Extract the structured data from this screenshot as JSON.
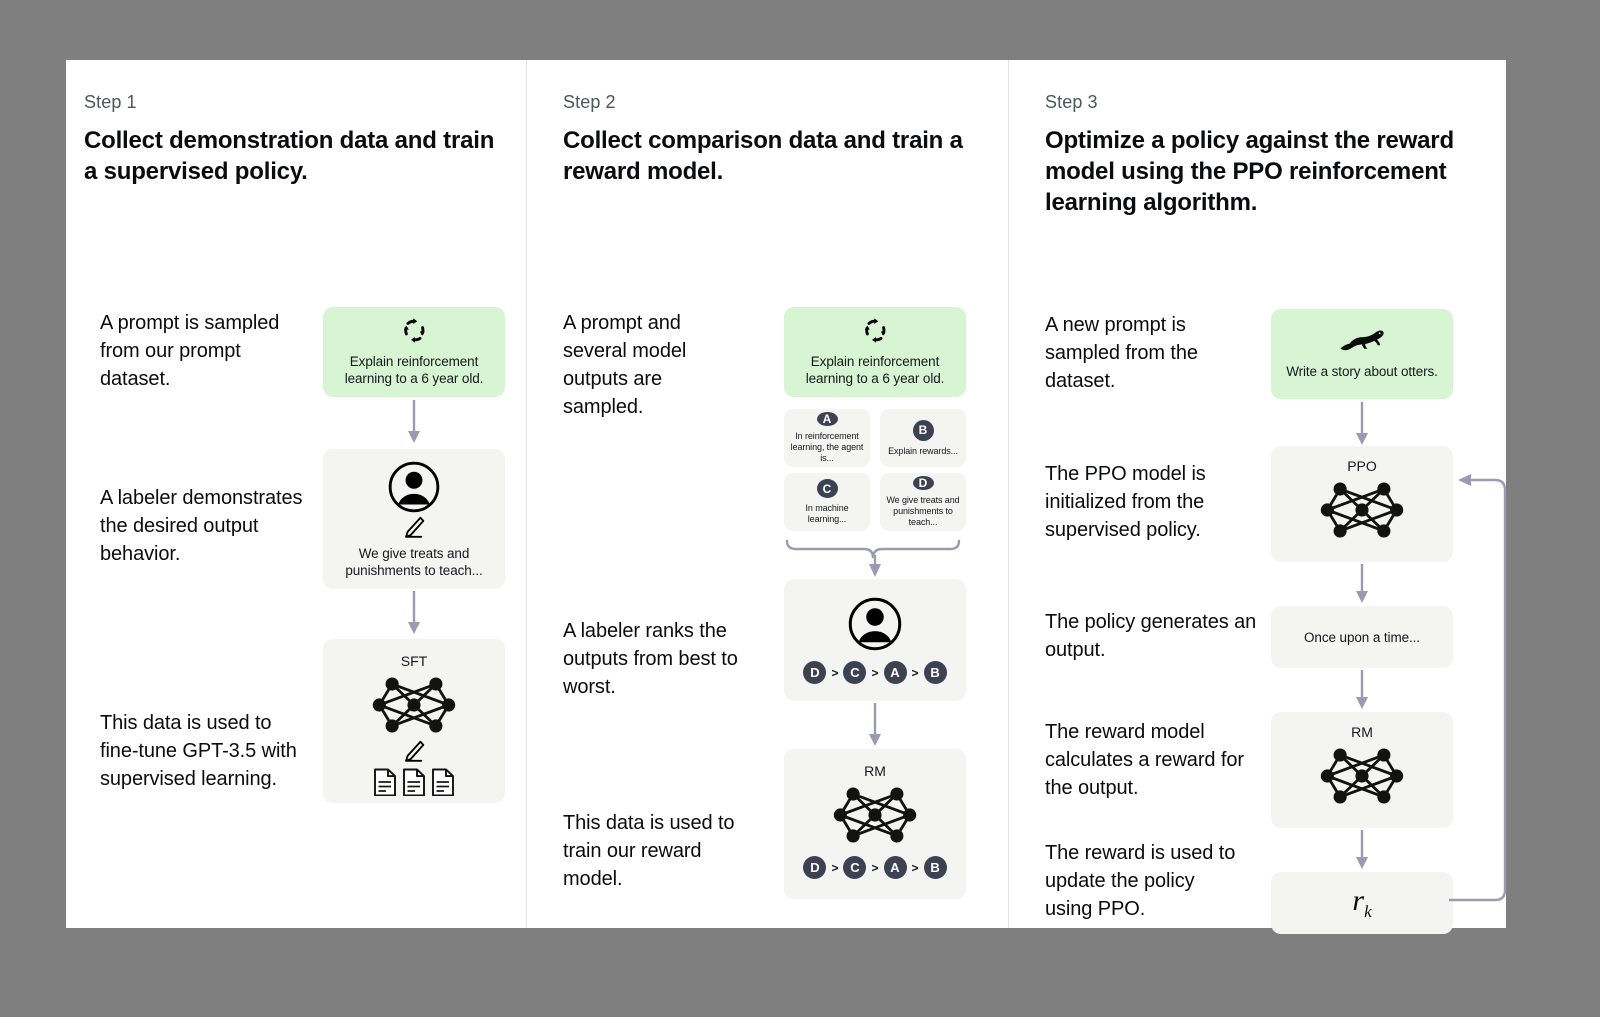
{
  "theme": {
    "background": "#7f7f7f",
    "card_background": "#ffffff",
    "green_box": "#d8f5d3",
    "gray_box": "#f4f4f2",
    "badge": "#3c4252",
    "arrow": "#9a9ab0",
    "text": "#0b0c0e",
    "step_label": "#50545c"
  },
  "columns": [
    {
      "step_label": "Step 1",
      "title": "Collect demonstration data and train a supervised policy.",
      "descriptions": [
        "A prompt is sampled from our prompt dataset.",
        "A labeler demonstrates the desired output behavior.",
        "This data is used to fine-tune GPT-3.5 with supervised learning."
      ],
      "prompt_box": {
        "icon": "cycle-icon",
        "text": "Explain reinforcement learning to a 6 year old."
      },
      "labeler_box": {
        "icon": "person-circle-icon",
        "pencil": "pencil-icon",
        "text": "We give treats and punishments to teach..."
      },
      "model_box": {
        "caption": "SFT",
        "icon": "neural-network-icon",
        "pencil": "pencil-icon",
        "documents": [
          "document-icon",
          "document-icon",
          "document-icon"
        ]
      }
    },
    {
      "step_label": "Step 2",
      "title": "Collect comparison data and train a reward model.",
      "descriptions": [
        "A prompt and several model outputs are sampled.",
        "A labeler ranks the outputs from best to worst.",
        "This data is used to train our reward model."
      ],
      "prompt_box": {
        "icon": "cycle-icon",
        "text": "Explain reinforcement learning to a 6 year old."
      },
      "outputs": [
        {
          "label": "A",
          "text": "In reinforcement learning, the agent is..."
        },
        {
          "label": "B",
          "text": "Explain rewards..."
        },
        {
          "label": "C",
          "text": "In machine learning..."
        },
        {
          "label": "D",
          "text": "We give treats and punishments to teach..."
        }
      ],
      "ranking_box": {
        "icon": "person-circle-icon",
        "ranking": [
          "D",
          "C",
          "A",
          "B"
        ],
        "separator": ">"
      },
      "reward_model_box": {
        "caption": "RM",
        "icon": "neural-network-icon",
        "ranking": [
          "D",
          "C",
          "A",
          "B"
        ],
        "separator": ">"
      }
    },
    {
      "step_label": "Step 3",
      "title": "Optimize a policy against the reward model using the PPO reinforcement learning algorithm.",
      "descriptions": [
        "A new prompt is sampled from the dataset.",
        "The PPO model is initialized from the supervised policy.",
        "The policy generates an output.",
        "The reward model calculates a reward for the output.",
        "The reward is used to update the policy using PPO."
      ],
      "prompt_box": {
        "icon": "otter-icon",
        "text": "Write a story about otters."
      },
      "ppo_box": {
        "caption": "PPO",
        "icon": "neural-network-icon"
      },
      "output_box": {
        "text": "Once upon a time..."
      },
      "rm_box": {
        "caption": "RM",
        "icon": "neural-network-icon"
      },
      "reward_box": {
        "symbol": "r",
        "subscript": "k"
      },
      "feedback_loop": "feedback-arrow"
    }
  ]
}
